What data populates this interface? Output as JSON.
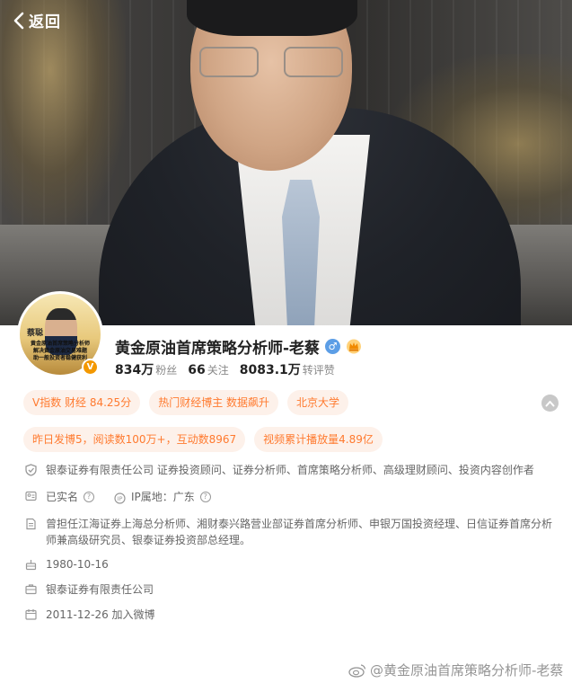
{
  "header": {
    "back_label": "返回"
  },
  "avatar": {
    "name_text": "蔡聪",
    "lines": [
      "黄金原油首席策略分析师",
      "解决黄金原油交易难题",
      "助一般投资者稳健获利"
    ]
  },
  "profile": {
    "name": "黄金原油首席策略分析师-老蔡",
    "verified_badge": "V",
    "gender_symbol": "♂",
    "stats": [
      {
        "value": "834万",
        "label": "粉丝"
      },
      {
        "value": "66",
        "label": "关注"
      },
      {
        "value": "8083.1万",
        "label": "转评赞"
      }
    ]
  },
  "tags": {
    "row1": [
      "V指数 财经 84.25分",
      "热门财经博主 数据飙升",
      "北京大学"
    ],
    "row2": [
      "昨日发博5，阅读数100万+，互动数8967",
      "视频累计播放量4.89亿"
    ]
  },
  "info": {
    "certification": "银泰证券有限责任公司 证券投资顾问、证券分析师、首席策略分析师、高级理财顾问、投资内容创作者",
    "real_name": "已实名",
    "ip_location": "IP属地：广东",
    "bio": "曾担任江海证券上海总分析师、湘财泰兴路营业部证券首席分析师、申银万国投资经理、日信证券首席分析师兼高级研究员、银泰证券投资部总经理。",
    "birthday": "1980-10-16",
    "company": "银泰证券有限责任公司",
    "joined": "2011-12-26 加入微博"
  },
  "watermark": "@黄金原油首席策略分析师-老蔡",
  "colors": {
    "tag_bg": "#fdf1ea",
    "tag_text": "#ff7a2f",
    "verified": "#f39800",
    "gender": "#5c9ee6"
  }
}
